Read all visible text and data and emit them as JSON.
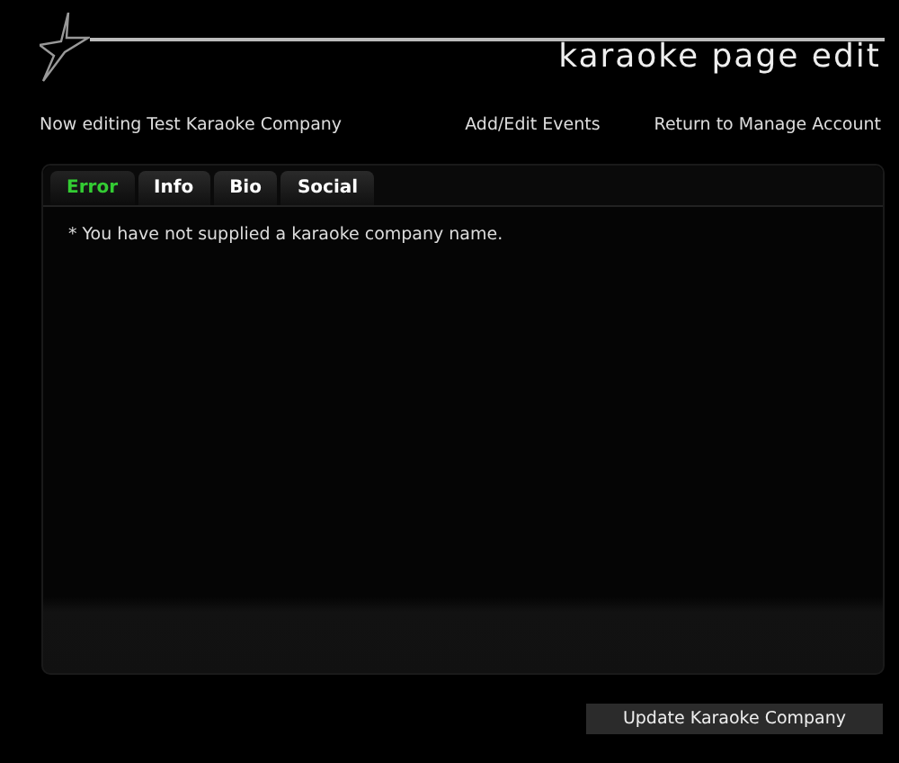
{
  "header": {
    "title": "karaoke page edit"
  },
  "nav": {
    "status": "Now editing Test Karaoke Company",
    "links": [
      "Add/Edit Events",
      "Return to Manage Account"
    ]
  },
  "tabs": [
    {
      "label": "Error",
      "selected": true
    },
    {
      "label": "Info",
      "selected": false
    },
    {
      "label": "Bio",
      "selected": false
    },
    {
      "label": "Social",
      "selected": false
    }
  ],
  "messages": [
    "* You have not supplied a karaoke company name."
  ],
  "button": "Update Karaoke Company"
}
